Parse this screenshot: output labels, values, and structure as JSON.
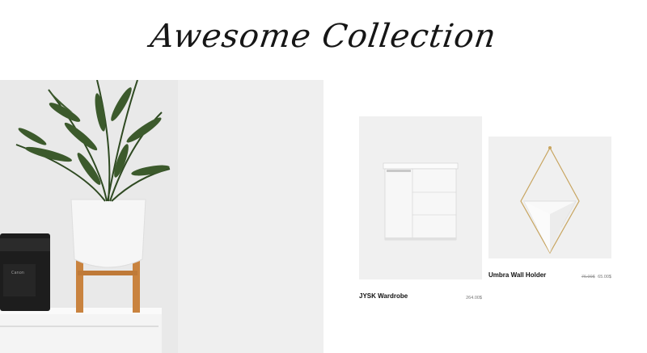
{
  "section": {
    "title": "Awesome Collection"
  },
  "hero": {
    "image_icon": "potted-plant-photo"
  },
  "products": [
    {
      "name": "JYSK Wardrobe",
      "price": "264.00$",
      "image_icon": "white-cabinet-image"
    },
    {
      "name": "Umbra Wall Holder",
      "old_price": "76.00$",
      "price": "65.00$",
      "image_icon": "geometric-wall-planter-image"
    }
  ]
}
